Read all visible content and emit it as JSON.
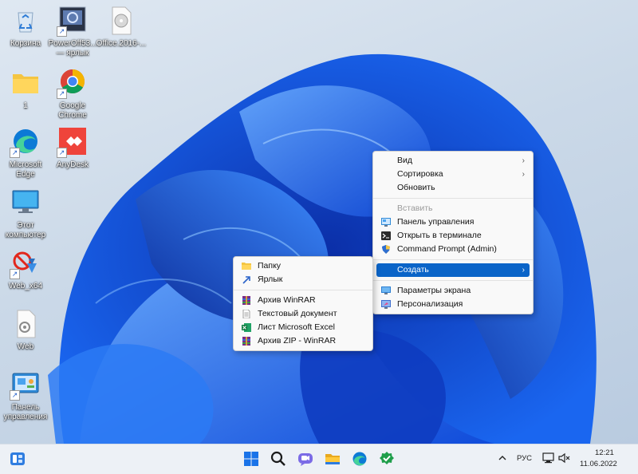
{
  "desktop": {
    "icons": [
      {
        "label": "Корзина",
        "icon": "recycle-bin-icon"
      },
      {
        "label": "PowerOff53...\n— ярлык",
        "icon": "poweroff-icon"
      },
      {
        "label": "Office.2016-...",
        "icon": "disc-image-icon"
      },
      {
        "label": "1",
        "icon": "folder-icon"
      },
      {
        "label": "Google\nChrome",
        "icon": "chrome-icon"
      },
      {
        "label": "Microsoft\nEdge",
        "icon": "edge-icon"
      },
      {
        "label": "AnyDesk",
        "icon": "anydesk-icon"
      },
      {
        "label": "Этот\nкомпьютер",
        "icon": "this-pc-icon"
      },
      {
        "label": "Web_x64",
        "icon": "web-x64-icon"
      },
      {
        "label": "Web",
        "icon": "web-file-icon"
      },
      {
        "label": "Панель\nуправления",
        "icon": "control-panel-icon"
      }
    ]
  },
  "context_menu": {
    "items": [
      {
        "label": "Вид",
        "submenu": true
      },
      {
        "label": "Сортировка",
        "submenu": true
      },
      {
        "label": "Обновить"
      },
      {
        "label": "Вставить",
        "disabled": true
      },
      {
        "label": "Панель управления",
        "icon": "control-panel-icon"
      },
      {
        "label": "Открыть в терминале",
        "icon": "terminal-icon"
      },
      {
        "label": "Command Prompt (Admin)",
        "icon": "shield-icon"
      },
      {
        "label": "Создать",
        "submenu": true,
        "highlighted": true
      },
      {
        "label": "Параметры экрана",
        "icon": "display-icon"
      },
      {
        "label": "Персонализация",
        "icon": "personalization-icon"
      }
    ]
  },
  "submenu_create": {
    "items": [
      {
        "label": "Папку",
        "icon": "folder-icon"
      },
      {
        "label": "Ярлык",
        "icon": "shortcut-icon"
      },
      {
        "label": "Архив WinRAR",
        "icon": "winrar-icon"
      },
      {
        "label": "Текстовый документ",
        "icon": "text-document-icon"
      },
      {
        "label": "Лист Microsoft Excel",
        "icon": "excel-icon"
      },
      {
        "label": "Архив ZIP - WinRAR",
        "icon": "winrar-zip-icon"
      }
    ]
  },
  "taskbar": {
    "apps": [
      "widgets-icon",
      "start-icon",
      "search-icon",
      "chat-icon",
      "file-explorer-icon",
      "edge-icon",
      "app-icon"
    ],
    "language": "РУС",
    "time": "12:21",
    "date": "11.06.2022"
  },
  "colors": {
    "accent": "#0a64c8",
    "wallpaper_blue": "#1e5fe0"
  }
}
